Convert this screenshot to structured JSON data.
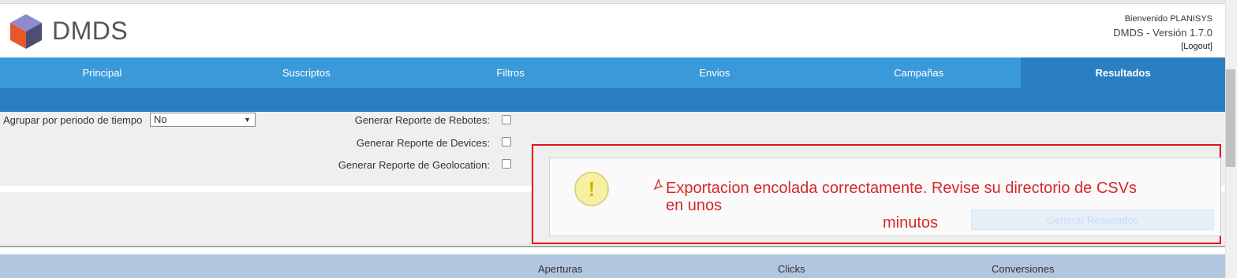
{
  "header": {
    "app_name": "DMDS",
    "welcome": "Bienvenido PLANISYS",
    "version": "DMDS - Versión 1.7.0",
    "logout": "[Logout]"
  },
  "nav": {
    "items": [
      "Principal",
      "Suscriptos",
      "Filtros",
      "Envios",
      "Campañas",
      "Resultados"
    ],
    "active": "Resultados"
  },
  "form": {
    "group_label": "Agrupar por periodo de tiempo",
    "group_value": "No",
    "rebotes_label": "Generar Reporte de Rebotes:",
    "devices_label": "Generar Reporte de Devices:",
    "geo_label": "Generar Reporte de Geolocation:"
  },
  "notification": {
    "message_line1": "Exportacion encolada correctamente. Revise su directorio de CSVs en unos",
    "message_line2": "minutos",
    "icon": "warning-icon",
    "icon_glyph": "!",
    "pdf_icon": "pdf-icon"
  },
  "generate_button": "Generar Resultados",
  "table": {
    "headers": [
      "Aperturas",
      "Clicks",
      "Conversiones"
    ]
  },
  "colors": {
    "nav": "#3a9ad9",
    "nav_active": "#2a7fc0",
    "highlight_border": "#e21414",
    "message": "#d62828",
    "table_header": "#b2c6df"
  }
}
